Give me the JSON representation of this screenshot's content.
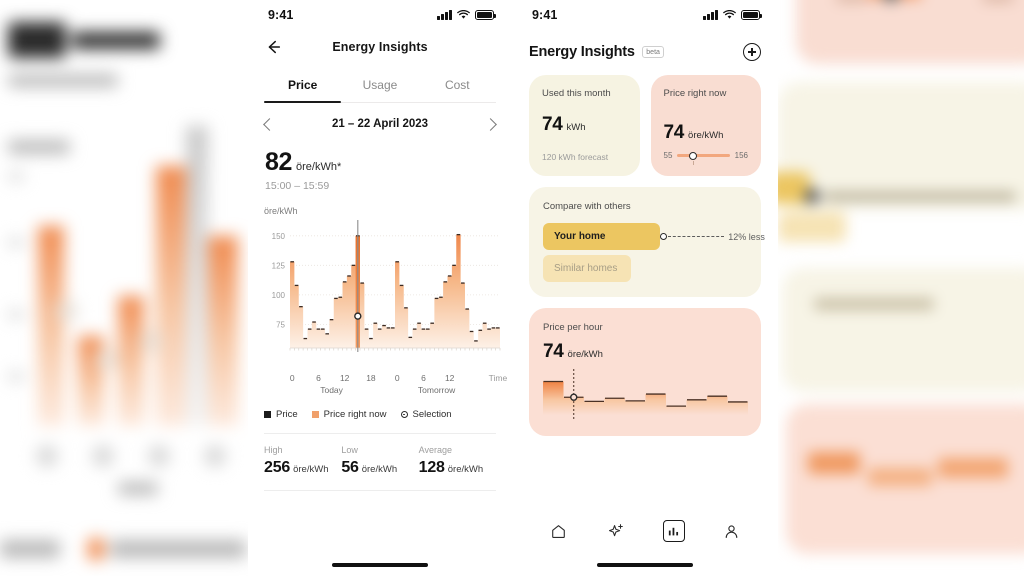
{
  "status_bar": {
    "time": "9:41",
    "signal_icon": "cellular-signal-icon",
    "wifi_icon": "wifi-icon",
    "battery_icon": "battery-icon"
  },
  "middle_screen": {
    "back_icon": "back-arrow-icon",
    "title": "Energy Insights",
    "tabs": [
      {
        "label": "Price",
        "active": true
      },
      {
        "label": "Usage",
        "active": false
      },
      {
        "label": "Cost",
        "active": false
      }
    ],
    "date_selector": {
      "prev_icon": "chevron-left-icon",
      "label": "21 – 22 April 2023",
      "next_icon": "chevron-right-icon"
    },
    "headline": {
      "value": "82",
      "unit": "öre/kWh*",
      "time_range": "15:00 – 15:59"
    },
    "legend": [
      {
        "label": "Price",
        "swatch": "black-square"
      },
      {
        "label": "Price right now",
        "swatch": "orange-square"
      },
      {
        "label": "Selection",
        "swatch": "ring-marker"
      }
    ],
    "stats": [
      {
        "label": "High",
        "value": "256",
        "unit": "öre/kWh"
      },
      {
        "label": "Low",
        "value": "56",
        "unit": "öre/kWh"
      },
      {
        "label": "Average",
        "value": "128",
        "unit": "öre/kWh"
      }
    ]
  },
  "chart_data": {
    "type": "area",
    "title": "",
    "ylabel": "öre/kWh",
    "xlabel": "Time",
    "ylim": [
      55,
      160
    ],
    "yticks": [
      75,
      100,
      125,
      150
    ],
    "xticks": [
      {
        "pos": 0,
        "label": "0"
      },
      {
        "pos": 6,
        "label": "6"
      },
      {
        "pos": 12,
        "label": "12"
      },
      {
        "pos": 18,
        "label": "18"
      },
      {
        "pos": 24,
        "label": "0"
      },
      {
        "pos": 30,
        "label": "6"
      },
      {
        "pos": 36,
        "label": "12"
      },
      {
        "pos": 46,
        "label": "Time"
      }
    ],
    "day_labels": [
      {
        "label": "Today",
        "center": 9
      },
      {
        "label": "Tomorrow",
        "center": 33
      }
    ],
    "grid": true,
    "legend_position": "below",
    "selection": {
      "hour": 15,
      "value": 82,
      "label": "15:00 – 15:59"
    },
    "hours": [
      0,
      1,
      2,
      3,
      4,
      5,
      6,
      7,
      8,
      9,
      10,
      11,
      12,
      13,
      14,
      15,
      16,
      17,
      18,
      19,
      20,
      21,
      22,
      23,
      24,
      25,
      26,
      27,
      28,
      29,
      30,
      31,
      32,
      33,
      34,
      35,
      36,
      37,
      38,
      39,
      40,
      41,
      42,
      43,
      44,
      45,
      46,
      47
    ],
    "values": [
      128,
      108,
      90,
      63,
      71,
      77,
      71,
      71,
      67,
      79,
      97,
      98,
      111,
      116,
      125,
      150,
      110,
      71,
      63,
      76,
      71,
      74,
      72,
      72,
      128,
      108,
      89,
      64,
      71,
      76,
      71,
      71,
      76,
      97,
      98,
      111,
      116,
      125,
      151,
      110,
      88,
      69,
      61,
      70,
      76,
      71,
      72,
      72
    ],
    "unit": "öre/kWh"
  },
  "right_screen": {
    "title": "Energy Insights",
    "badge": "beta",
    "add_icon": "plus-circle-icon",
    "cards": {
      "used_this_month": {
        "label": "Used this month",
        "value": "74",
        "unit": "kWh",
        "sub": "120 kWh forecast",
        "bg": "#f6f3e2"
      },
      "price_right_now": {
        "label": "Price right now",
        "value": "74",
        "unit": "öre/kWh",
        "min": "55",
        "max": "156",
        "bg": "#f9ddd2"
      },
      "compare": {
        "label": "Compare with others",
        "bars": [
          {
            "label": "Your home",
            "highlight": true
          },
          {
            "label": "Similar homes",
            "highlight": false
          }
        ],
        "annotation": "12% less",
        "bg": "#f7f4e6"
      },
      "price_per_hour": {
        "label": "Price per hour",
        "value": "74",
        "unit": "öre/kWh",
        "bg": "#fbdfd4",
        "series": [
          104,
          74,
          66,
          72,
          67,
          80,
          57,
          69,
          76,
          65
        ]
      }
    },
    "bottom_nav": [
      {
        "icon": "home-icon",
        "active": false
      },
      {
        "icon": "sparkle-icon",
        "active": false
      },
      {
        "icon": "bar-chart-icon",
        "active": true
      },
      {
        "icon": "person-icon",
        "active": false
      }
    ]
  }
}
